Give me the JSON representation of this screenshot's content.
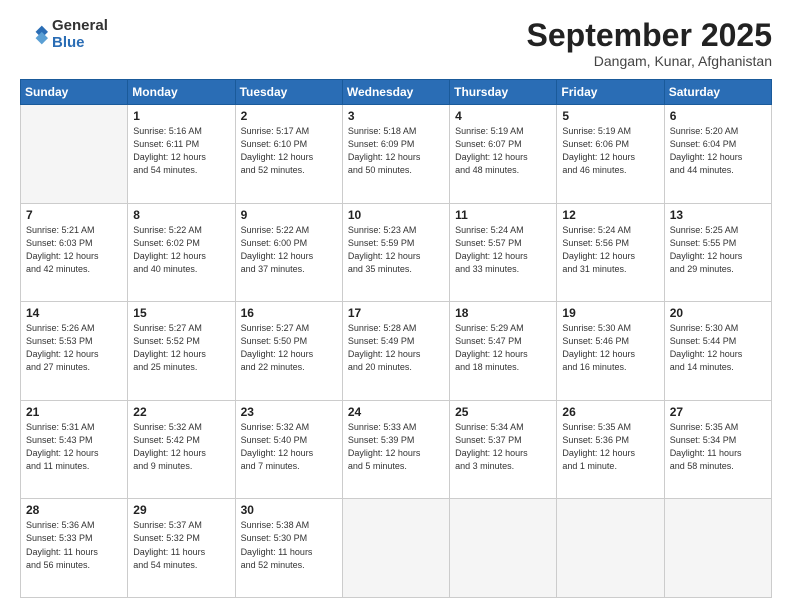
{
  "logo": {
    "general": "General",
    "blue": "Blue"
  },
  "title": "September 2025",
  "location": "Dangam, Kunar, Afghanistan",
  "days_header": [
    "Sunday",
    "Monday",
    "Tuesday",
    "Wednesday",
    "Thursday",
    "Friday",
    "Saturday"
  ],
  "weeks": [
    [
      {
        "day": "",
        "info": ""
      },
      {
        "day": "1",
        "info": "Sunrise: 5:16 AM\nSunset: 6:11 PM\nDaylight: 12 hours\nand 54 minutes."
      },
      {
        "day": "2",
        "info": "Sunrise: 5:17 AM\nSunset: 6:10 PM\nDaylight: 12 hours\nand 52 minutes."
      },
      {
        "day": "3",
        "info": "Sunrise: 5:18 AM\nSunset: 6:09 PM\nDaylight: 12 hours\nand 50 minutes."
      },
      {
        "day": "4",
        "info": "Sunrise: 5:19 AM\nSunset: 6:07 PM\nDaylight: 12 hours\nand 48 minutes."
      },
      {
        "day": "5",
        "info": "Sunrise: 5:19 AM\nSunset: 6:06 PM\nDaylight: 12 hours\nand 46 minutes."
      },
      {
        "day": "6",
        "info": "Sunrise: 5:20 AM\nSunset: 6:04 PM\nDaylight: 12 hours\nand 44 minutes."
      }
    ],
    [
      {
        "day": "7",
        "info": "Sunrise: 5:21 AM\nSunset: 6:03 PM\nDaylight: 12 hours\nand 42 minutes."
      },
      {
        "day": "8",
        "info": "Sunrise: 5:22 AM\nSunset: 6:02 PM\nDaylight: 12 hours\nand 40 minutes."
      },
      {
        "day": "9",
        "info": "Sunrise: 5:22 AM\nSunset: 6:00 PM\nDaylight: 12 hours\nand 37 minutes."
      },
      {
        "day": "10",
        "info": "Sunrise: 5:23 AM\nSunset: 5:59 PM\nDaylight: 12 hours\nand 35 minutes."
      },
      {
        "day": "11",
        "info": "Sunrise: 5:24 AM\nSunset: 5:57 PM\nDaylight: 12 hours\nand 33 minutes."
      },
      {
        "day": "12",
        "info": "Sunrise: 5:24 AM\nSunset: 5:56 PM\nDaylight: 12 hours\nand 31 minutes."
      },
      {
        "day": "13",
        "info": "Sunrise: 5:25 AM\nSunset: 5:55 PM\nDaylight: 12 hours\nand 29 minutes."
      }
    ],
    [
      {
        "day": "14",
        "info": "Sunrise: 5:26 AM\nSunset: 5:53 PM\nDaylight: 12 hours\nand 27 minutes."
      },
      {
        "day": "15",
        "info": "Sunrise: 5:27 AM\nSunset: 5:52 PM\nDaylight: 12 hours\nand 25 minutes."
      },
      {
        "day": "16",
        "info": "Sunrise: 5:27 AM\nSunset: 5:50 PM\nDaylight: 12 hours\nand 22 minutes."
      },
      {
        "day": "17",
        "info": "Sunrise: 5:28 AM\nSunset: 5:49 PM\nDaylight: 12 hours\nand 20 minutes."
      },
      {
        "day": "18",
        "info": "Sunrise: 5:29 AM\nSunset: 5:47 PM\nDaylight: 12 hours\nand 18 minutes."
      },
      {
        "day": "19",
        "info": "Sunrise: 5:30 AM\nSunset: 5:46 PM\nDaylight: 12 hours\nand 16 minutes."
      },
      {
        "day": "20",
        "info": "Sunrise: 5:30 AM\nSunset: 5:44 PM\nDaylight: 12 hours\nand 14 minutes."
      }
    ],
    [
      {
        "day": "21",
        "info": "Sunrise: 5:31 AM\nSunset: 5:43 PM\nDaylight: 12 hours\nand 11 minutes."
      },
      {
        "day": "22",
        "info": "Sunrise: 5:32 AM\nSunset: 5:42 PM\nDaylight: 12 hours\nand 9 minutes."
      },
      {
        "day": "23",
        "info": "Sunrise: 5:32 AM\nSunset: 5:40 PM\nDaylight: 12 hours\nand 7 minutes."
      },
      {
        "day": "24",
        "info": "Sunrise: 5:33 AM\nSunset: 5:39 PM\nDaylight: 12 hours\nand 5 minutes."
      },
      {
        "day": "25",
        "info": "Sunrise: 5:34 AM\nSunset: 5:37 PM\nDaylight: 12 hours\nand 3 minutes."
      },
      {
        "day": "26",
        "info": "Sunrise: 5:35 AM\nSunset: 5:36 PM\nDaylight: 12 hours\nand 1 minute."
      },
      {
        "day": "27",
        "info": "Sunrise: 5:35 AM\nSunset: 5:34 PM\nDaylight: 11 hours\nand 58 minutes."
      }
    ],
    [
      {
        "day": "28",
        "info": "Sunrise: 5:36 AM\nSunset: 5:33 PM\nDaylight: 11 hours\nand 56 minutes."
      },
      {
        "day": "29",
        "info": "Sunrise: 5:37 AM\nSunset: 5:32 PM\nDaylight: 11 hours\nand 54 minutes."
      },
      {
        "day": "30",
        "info": "Sunrise: 5:38 AM\nSunset: 5:30 PM\nDaylight: 11 hours\nand 52 minutes."
      },
      {
        "day": "",
        "info": ""
      },
      {
        "day": "",
        "info": ""
      },
      {
        "day": "",
        "info": ""
      },
      {
        "day": "",
        "info": ""
      }
    ]
  ]
}
